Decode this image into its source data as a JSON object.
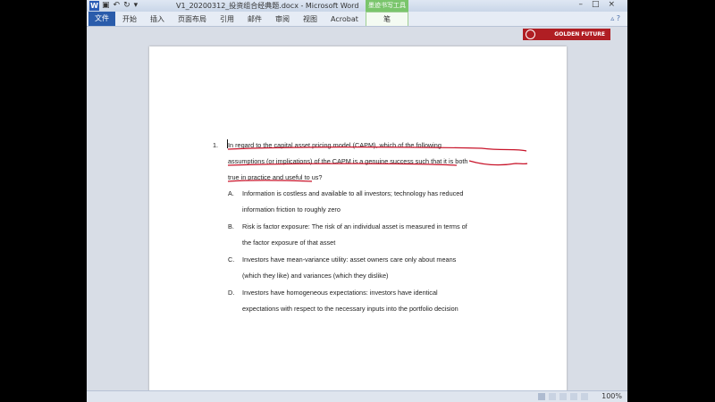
{
  "window": {
    "title": "V1_20200312_投资组合经典题.docx - Microsoft Word",
    "tool_tab": "墨迹书写工具",
    "app_icon": "W"
  },
  "ribbon": {
    "file_label": "文件",
    "tabs": [
      "开始",
      "插入",
      "页面布局",
      "引用",
      "邮件",
      "审阅",
      "视图",
      "Acrobat"
    ],
    "pen_tab": "笔"
  },
  "header_logo": {
    "text": "GOLDEN FUTURE"
  },
  "question": {
    "number": "1.",
    "lines": [
      "In regard to the capital asset pricing model (CAPM), which of the following",
      "assumptions (or implications) of the CAPM is a genuine success such that it is both",
      "true in practice and useful to us?"
    ],
    "options": [
      {
        "letter": "A.",
        "lines": [
          "Information is costless and available to all investors; technology has reduced",
          "information friction to roughly zero"
        ]
      },
      {
        "letter": "B.",
        "lines": [
          "Risk is factor exposure: The risk of an individual asset is measured in terms of",
          "the factor exposure of that asset"
        ]
      },
      {
        "letter": "C.",
        "lines": [
          "Investors have mean-variance utility: asset owners care only about means",
          "(which they like) and variances (which they dislike)"
        ]
      },
      {
        "letter": "D.",
        "lines": [
          "Investors have homogeneous expectations: investors have identical",
          "expectations with respect to the necessary inputs into the portfolio decision"
        ]
      }
    ]
  },
  "status": {
    "zoom": "100%"
  },
  "colors": {
    "ink": "#c8142a",
    "file_tab": "#2a5cab",
    "logo": "#b01e23"
  }
}
